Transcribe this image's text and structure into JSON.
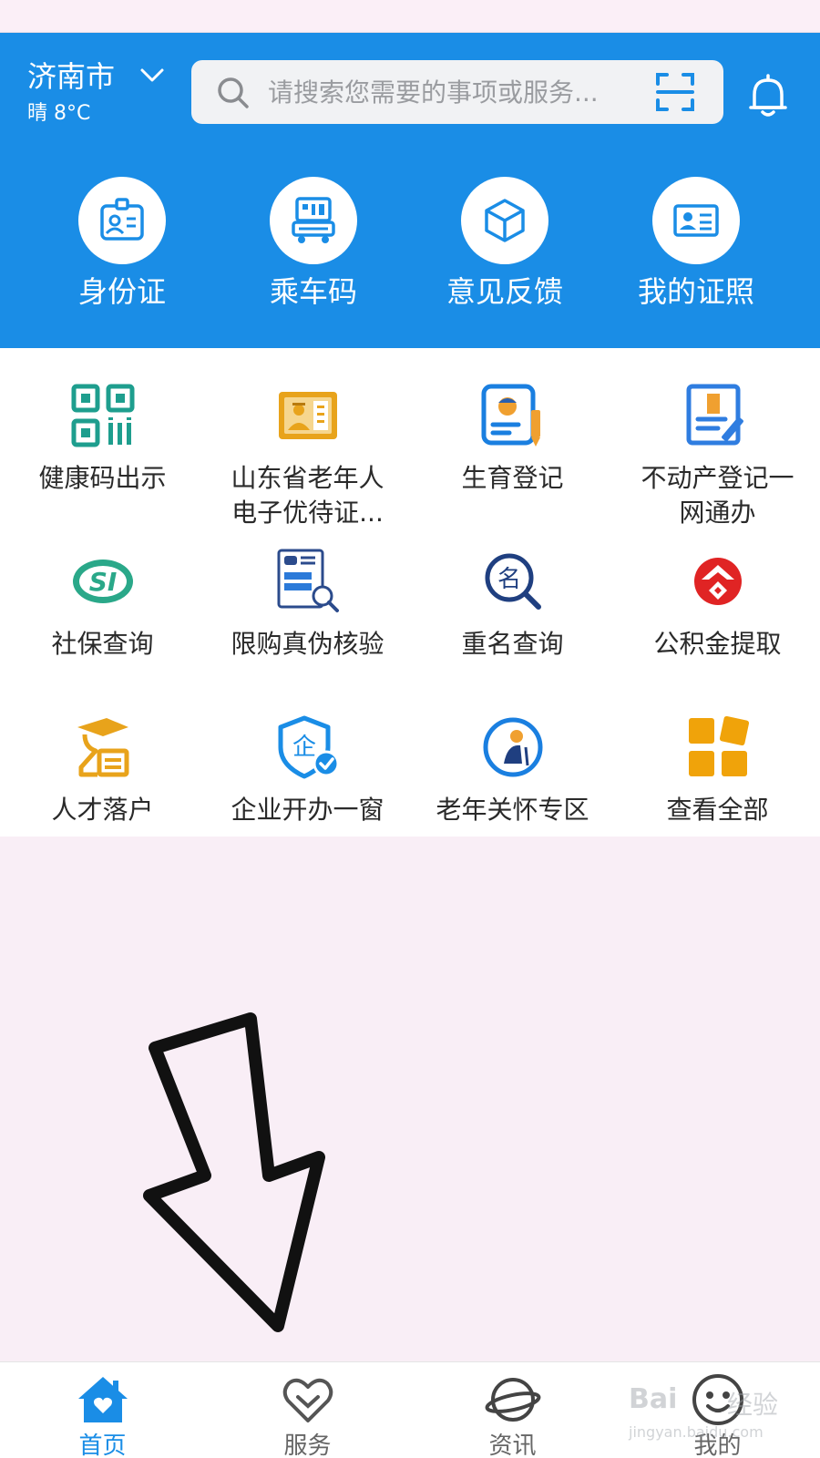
{
  "header": {
    "city": "济南市",
    "weather": "晴 8°C",
    "search_placeholder": "请搜索您需要的事项或服务...",
    "background": "#1a8de6"
  },
  "quick_actions": [
    {
      "label": "身份证",
      "icon": "id-badge-icon"
    },
    {
      "label": "乘车码",
      "icon": "bus-code-icon"
    },
    {
      "label": "意见反馈",
      "icon": "cube-feedback-icon"
    },
    {
      "label": "我的证照",
      "icon": "license-card-icon"
    }
  ],
  "services": [
    {
      "label": "健康码出示",
      "icon": "qr-code-icon",
      "color": "#1e9e8e"
    },
    {
      "label": "山东省老年人电子优待证...",
      "icon": "elder-card-icon",
      "color": "#e8a31b"
    },
    {
      "label": "生育登记",
      "icon": "birth-register-icon",
      "color": "#1a7fe0"
    },
    {
      "label": "不动产登记一网通办",
      "icon": "property-register-icon",
      "color": "#2f7de0"
    },
    {
      "label": "社保查询",
      "icon": "social-security-icon",
      "color": "#2aa889"
    },
    {
      "label": "限购真伪核验",
      "icon": "document-search-icon",
      "color": "#2b4b8c"
    },
    {
      "label": "重名查询",
      "icon": "name-search-icon",
      "color": "#1f3f80"
    },
    {
      "label": "公积金提取",
      "icon": "housing-fund-icon",
      "color": "#e02424"
    },
    {
      "label": "人才落户",
      "icon": "graduate-icon",
      "color": "#e8a31b"
    },
    {
      "label": "企业开办一窗",
      "icon": "enterprise-shield-icon",
      "color": "#1a8de6"
    },
    {
      "label": "老年关怀专区",
      "icon": "elder-care-icon",
      "color": "#1a7fe0"
    },
    {
      "label": "查看全部",
      "icon": "all-apps-icon",
      "color": "#f0a30a"
    }
  ],
  "bottom_nav": [
    {
      "label": "首页",
      "icon": "home-icon",
      "active": true
    },
    {
      "label": "服务",
      "icon": "heart-service-icon",
      "active": false
    },
    {
      "label": "资讯",
      "icon": "planet-news-icon",
      "active": false
    },
    {
      "label": "我的",
      "icon": "smiley-profile-icon",
      "active": false
    }
  ],
  "watermark": {
    "line1": "Bai",
    "line2": "经验",
    "line3": "jingyan.baidu.com"
  }
}
